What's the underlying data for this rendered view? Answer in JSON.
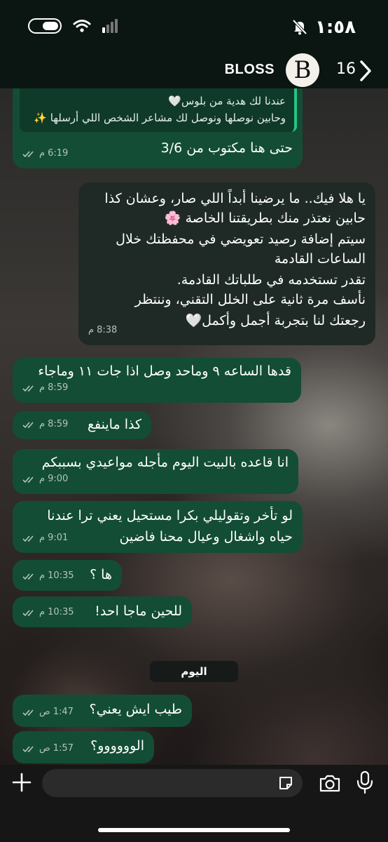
{
  "status_bar": {
    "time": "١:٥٨",
    "icons": [
      "bell-off-icon",
      "toggle-icon",
      "wifi-icon",
      "signal-icon"
    ]
  },
  "header": {
    "unread_count": "16",
    "avatar_letter": "B",
    "contact_name": "BLOSS",
    "icons": [
      "chevron-left-icon"
    ]
  },
  "messages": [
    {
      "direction": "out",
      "quote": {
        "line1": "عندنا لك هدية من بلوس🤍",
        "line2": "وحابين نوصلها ونوصل لك مشاعر الشخص اللي أرسلها ✨"
      },
      "text": "حتى هنا مكتوب من 3/6",
      "time": "6:19",
      "ampm": "م"
    },
    {
      "direction": "in",
      "lines": [
        "يا هلا فيك.. ما يرضينا أبداً اللي صار، وعشان كذا",
        "حابين نعتذر منك بطريقتنا الخاصة 🌸",
        "سيتم إضافة رصيد تعويضي في محفظتك خلال",
        "الساعات القادمة",
        "تقدر تستخدمه في طلباتك القادمة.",
        "نأسف مرة ثانية على الخلل التقني، وننتظر",
        "رجعتك لنا بتجربة أجمل وأكمل🤍"
      ],
      "time": "8:38",
      "ampm": "م"
    },
    {
      "direction": "out",
      "text": "قدها الساعه ٩ وماحد وصل اذا جات ١١ وماجاء",
      "time": "8:59",
      "ampm": "م"
    },
    {
      "direction": "out",
      "text": "كذا ماينفع",
      "time": "8:59",
      "ampm": "م"
    },
    {
      "direction": "out",
      "text": "انا قاعده بالبيت اليوم مأجله مواعيدي بسببكم",
      "time": "9:00",
      "ampm": "م"
    },
    {
      "direction": "out",
      "lines": [
        "لو تأخر وتقوليلي بكرا مستحيل يعني ترا عندنا",
        "حياه واشغال وعيال محنا فاضين"
      ],
      "time": "9:01",
      "ampm": "م"
    },
    {
      "direction": "out",
      "text": "ها ؟",
      "time": "10:35",
      "ampm": "م"
    },
    {
      "direction": "out",
      "text": "للحين ماجا احد!",
      "time": "10:35",
      "ampm": "م"
    },
    {
      "direction": "out",
      "text": "طيب ايش يعني؟",
      "time": "1:47",
      "ampm": "ص"
    },
    {
      "direction": "out",
      "text": "الوووووو؟",
      "time": "1:57",
      "ampm": "ص"
    }
  ],
  "day_separator": "اليوم",
  "input_bar": {
    "placeholder": "",
    "icons": [
      "plus-icon",
      "sticker-icon",
      "camera-icon",
      "microphone-icon"
    ]
  },
  "colors": {
    "outgoing_bubble": "#134d36",
    "incoming_bubble": "#1f2a26",
    "quote_accent": "#28c285",
    "header_bg": "#0b1512"
  }
}
